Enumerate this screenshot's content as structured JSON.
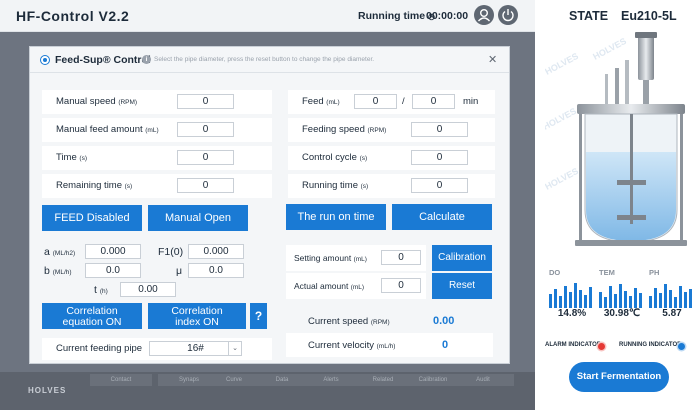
{
  "header": {
    "title": "HF-Control V2.2",
    "running_time_label": "Running time",
    "running_time_value": "00:00:00"
  },
  "right_panel": {
    "state_label": "STATE",
    "state_value": "Eu210-5L",
    "metrics": [
      {
        "label": "DO",
        "value": "14.8%"
      },
      {
        "label": "TEM",
        "value": "30.98℃"
      },
      {
        "label": "PH",
        "value": "5.87"
      }
    ],
    "alarm_indicator": "ALARM INDICATOR",
    "running_indicator": "RUNNING INDICATOR",
    "start_button": "Start Fermentation"
  },
  "footer": {
    "logo": "HOLVES",
    "tabs": [
      "Contact",
      "Synaps",
      "Curve",
      "Data",
      "Alerts",
      "Related",
      "Calibration",
      "Audit"
    ]
  },
  "dialog": {
    "title": "Feed-Sup® Control",
    "hint": "Select the pipe diameter, press the reset button to change the pipe diameter.",
    "left_rows": [
      {
        "label": "Manual speed",
        "unit": "(RPM)",
        "value": "0"
      },
      {
        "label": "Manual feed amount",
        "unit": "(mL)",
        "value": "0"
      },
      {
        "label": "Time",
        "unit": "(s)",
        "value": "0"
      },
      {
        "label": "Remaining time",
        "unit": "(s)",
        "value": "0"
      }
    ],
    "feed_row": {
      "label": "Feed",
      "unit": "(mL)",
      "value1": "0",
      "separator": "/",
      "value2": "0",
      "suffix": "min"
    },
    "right_rows": [
      {
        "label": "Feeding speed",
        "unit": "(RPM)",
        "value": "0"
      },
      {
        "label": "Control cycle",
        "unit": "(s)",
        "value": "0"
      },
      {
        "label": "Running time",
        "unit": "(s)",
        "value": "0"
      }
    ],
    "buttons": {
      "feed_disabled": "FEED Disabled",
      "manual_open": "Manual Open",
      "run_on_time": "The run on time",
      "calculate": "Calculate",
      "calibration": "Calibration",
      "reset": "Reset",
      "corr_equation_1": "Correlation",
      "corr_equation_2": "equation ON",
      "corr_index_1": "Correlation",
      "corr_index_2": "index ON",
      "help": "?"
    },
    "coeffs": {
      "a_label": "a",
      "a_unit": "(ML/h2)",
      "a_value": "0.000",
      "b_label": "b",
      "b_unit": "(ML/h)",
      "b_value": "0.0",
      "t_label": "t",
      "t_unit": "(h)",
      "t_value": "0.00",
      "f1_label": "F1(0)",
      "f1_value": "0.000",
      "mu_label": "μ",
      "mu_value": "0.0"
    },
    "setting_amount": {
      "label": "Setting amount",
      "unit": "(mL)",
      "value": "0"
    },
    "actual_amount": {
      "label": "Actual amount",
      "unit": "(mL)",
      "value": "0"
    },
    "current_speed": {
      "label": "Current speed",
      "unit": "(RPM)",
      "value": "0.00"
    },
    "current_velocity": {
      "label": "Current velocity",
      "unit": "(mL/h)",
      "value": "0"
    },
    "feeding_pipe": {
      "label": "Current feeding pipe",
      "value": "16#"
    }
  }
}
